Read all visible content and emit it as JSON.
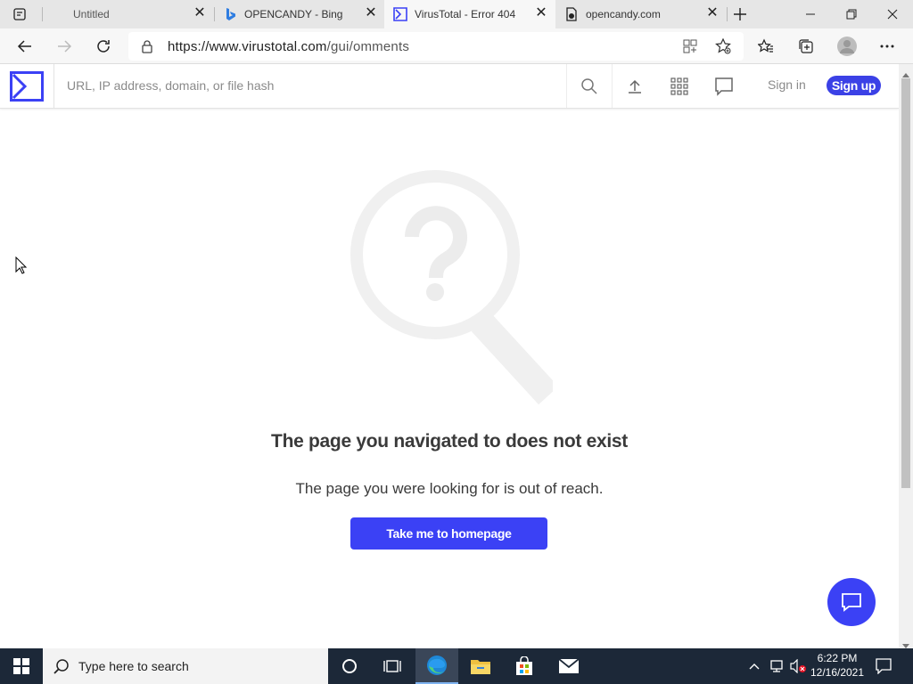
{
  "browser": {
    "tabs": [
      {
        "label": "Untitled",
        "favicon": "blank-page-icon",
        "active": false
      },
      {
        "label": "OPENCANDY - Bing",
        "favicon": "bing-icon",
        "active": false
      },
      {
        "label": "VirusTotal - Error 404",
        "favicon": "virustotal-icon",
        "active": true
      },
      {
        "label": "opencandy.com",
        "favicon": "web-page-icon",
        "active": false
      }
    ],
    "url_host": "https://www.virustotal.com",
    "url_path": "/gui/omments"
  },
  "site": {
    "search_placeholder": "URL, IP address, domain, or file hash",
    "signin_label": "Sign in",
    "signup_label": "Sign up",
    "accent_color": "#3b41f5"
  },
  "error": {
    "title": "The page you navigated to does not exist",
    "message": "The page you were looking for is out of reach.",
    "button_label": "Take me to homepage"
  },
  "taskbar": {
    "search_placeholder": "Type here to search",
    "time": "6:22 PM",
    "date": "12/16/2021"
  }
}
